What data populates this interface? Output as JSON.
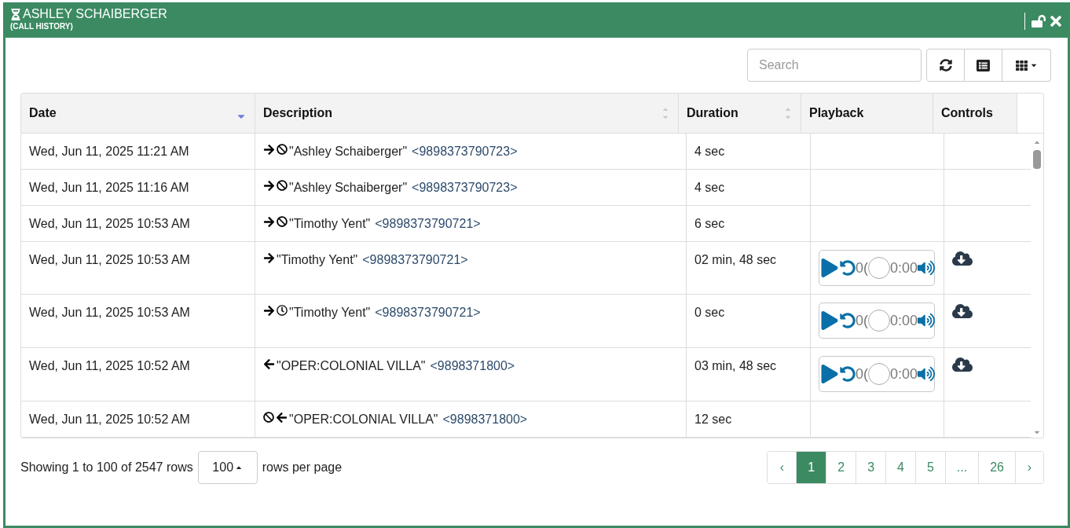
{
  "window": {
    "title": "ASHLEY SCHAIBERGER",
    "subtitle": "(CALL HISTORY)",
    "locked": false
  },
  "toolbar": {
    "search": {
      "placeholder": "Search"
    }
  },
  "table": {
    "columns": [
      {
        "label": "Date",
        "sorted": true
      },
      {
        "label": "Description",
        "sortable": true,
        "sorted": false
      },
      {
        "label": "Duration",
        "sortable": true,
        "sorted": false
      },
      {
        "label": "Playback"
      },
      {
        "label": "Controls"
      }
    ],
    "rows": [
      {
        "date": "Wed, Jun 11, 2025 11:21 AM",
        "icons": [
          {
            "kind": "outgoing"
          },
          {
            "kind": "blocked"
          }
        ],
        "name": "\"Ashley Schaiberger\"",
        "number": "<9898373790723>",
        "duration": "4 sec",
        "recording": false
      },
      {
        "date": "Wed, Jun 11, 2025 11:16 AM",
        "icons": [
          {
            "kind": "outgoing"
          },
          {
            "kind": "blocked"
          }
        ],
        "name": "\"Ashley Schaiberger\"",
        "number": "<9898373790723>",
        "duration": "4 sec",
        "recording": false
      },
      {
        "date": "Wed, Jun 11, 2025 10:53 AM",
        "icons": [
          {
            "kind": "outgoing"
          },
          {
            "kind": "blocked"
          }
        ],
        "name": "\"Timothy Yent\"",
        "number": "<9898373790721>",
        "duration": "6 sec",
        "recording": false
      },
      {
        "date": "Wed, Jun 11, 2025 10:53 AM",
        "icons": [
          {
            "kind": "outgoing"
          }
        ],
        "name": "\"Timothy Yent\"",
        "number": "<9898373790721>",
        "duration": "02 min, 48 sec",
        "recording": true,
        "player": {
          "elapsed": "0(",
          "total": "0:00"
        }
      },
      {
        "date": "Wed, Jun 11, 2025 10:53 AM",
        "icons": [
          {
            "kind": "outgoing"
          },
          {
            "kind": "timer"
          }
        ],
        "name": "\"Timothy Yent\"",
        "number": "<9898373790721>",
        "duration": "0 sec",
        "recording": true,
        "player": {
          "elapsed": "0(",
          "total": "0:00"
        }
      },
      {
        "date": "Wed, Jun 11, 2025 10:52 AM",
        "icons": [
          {
            "kind": "incoming"
          }
        ],
        "name": "\"OPER:COLONIAL VILLA\"",
        "number": "<9898371800>",
        "duration": "03 min, 48 sec",
        "recording": true,
        "player": {
          "elapsed": "0(",
          "total": "0:00"
        }
      },
      {
        "date": "Wed, Jun 11, 2025 10:52 AM",
        "icons": [
          {
            "kind": "blocked"
          },
          {
            "kind": "incoming"
          }
        ],
        "name": "\"OPER:COLONIAL VILLA\"",
        "number": "<9898371800>",
        "duration": "12 sec",
        "recording": false
      }
    ]
  },
  "footer": {
    "summary": "Showing 1 to 100 of 2547 rows",
    "page_size": "100",
    "page_size_label": "rows per page",
    "pages": [
      {
        "label": "‹",
        "selected": false
      },
      {
        "label": "1",
        "selected": true
      },
      {
        "label": "2",
        "selected": false
      },
      {
        "label": "3",
        "selected": false
      },
      {
        "label": "4",
        "selected": false
      },
      {
        "label": "5",
        "selected": false
      },
      {
        "label": "...",
        "selected": false
      },
      {
        "label": "26",
        "selected": false
      },
      {
        "label": "›",
        "selected": false
      }
    ]
  }
}
